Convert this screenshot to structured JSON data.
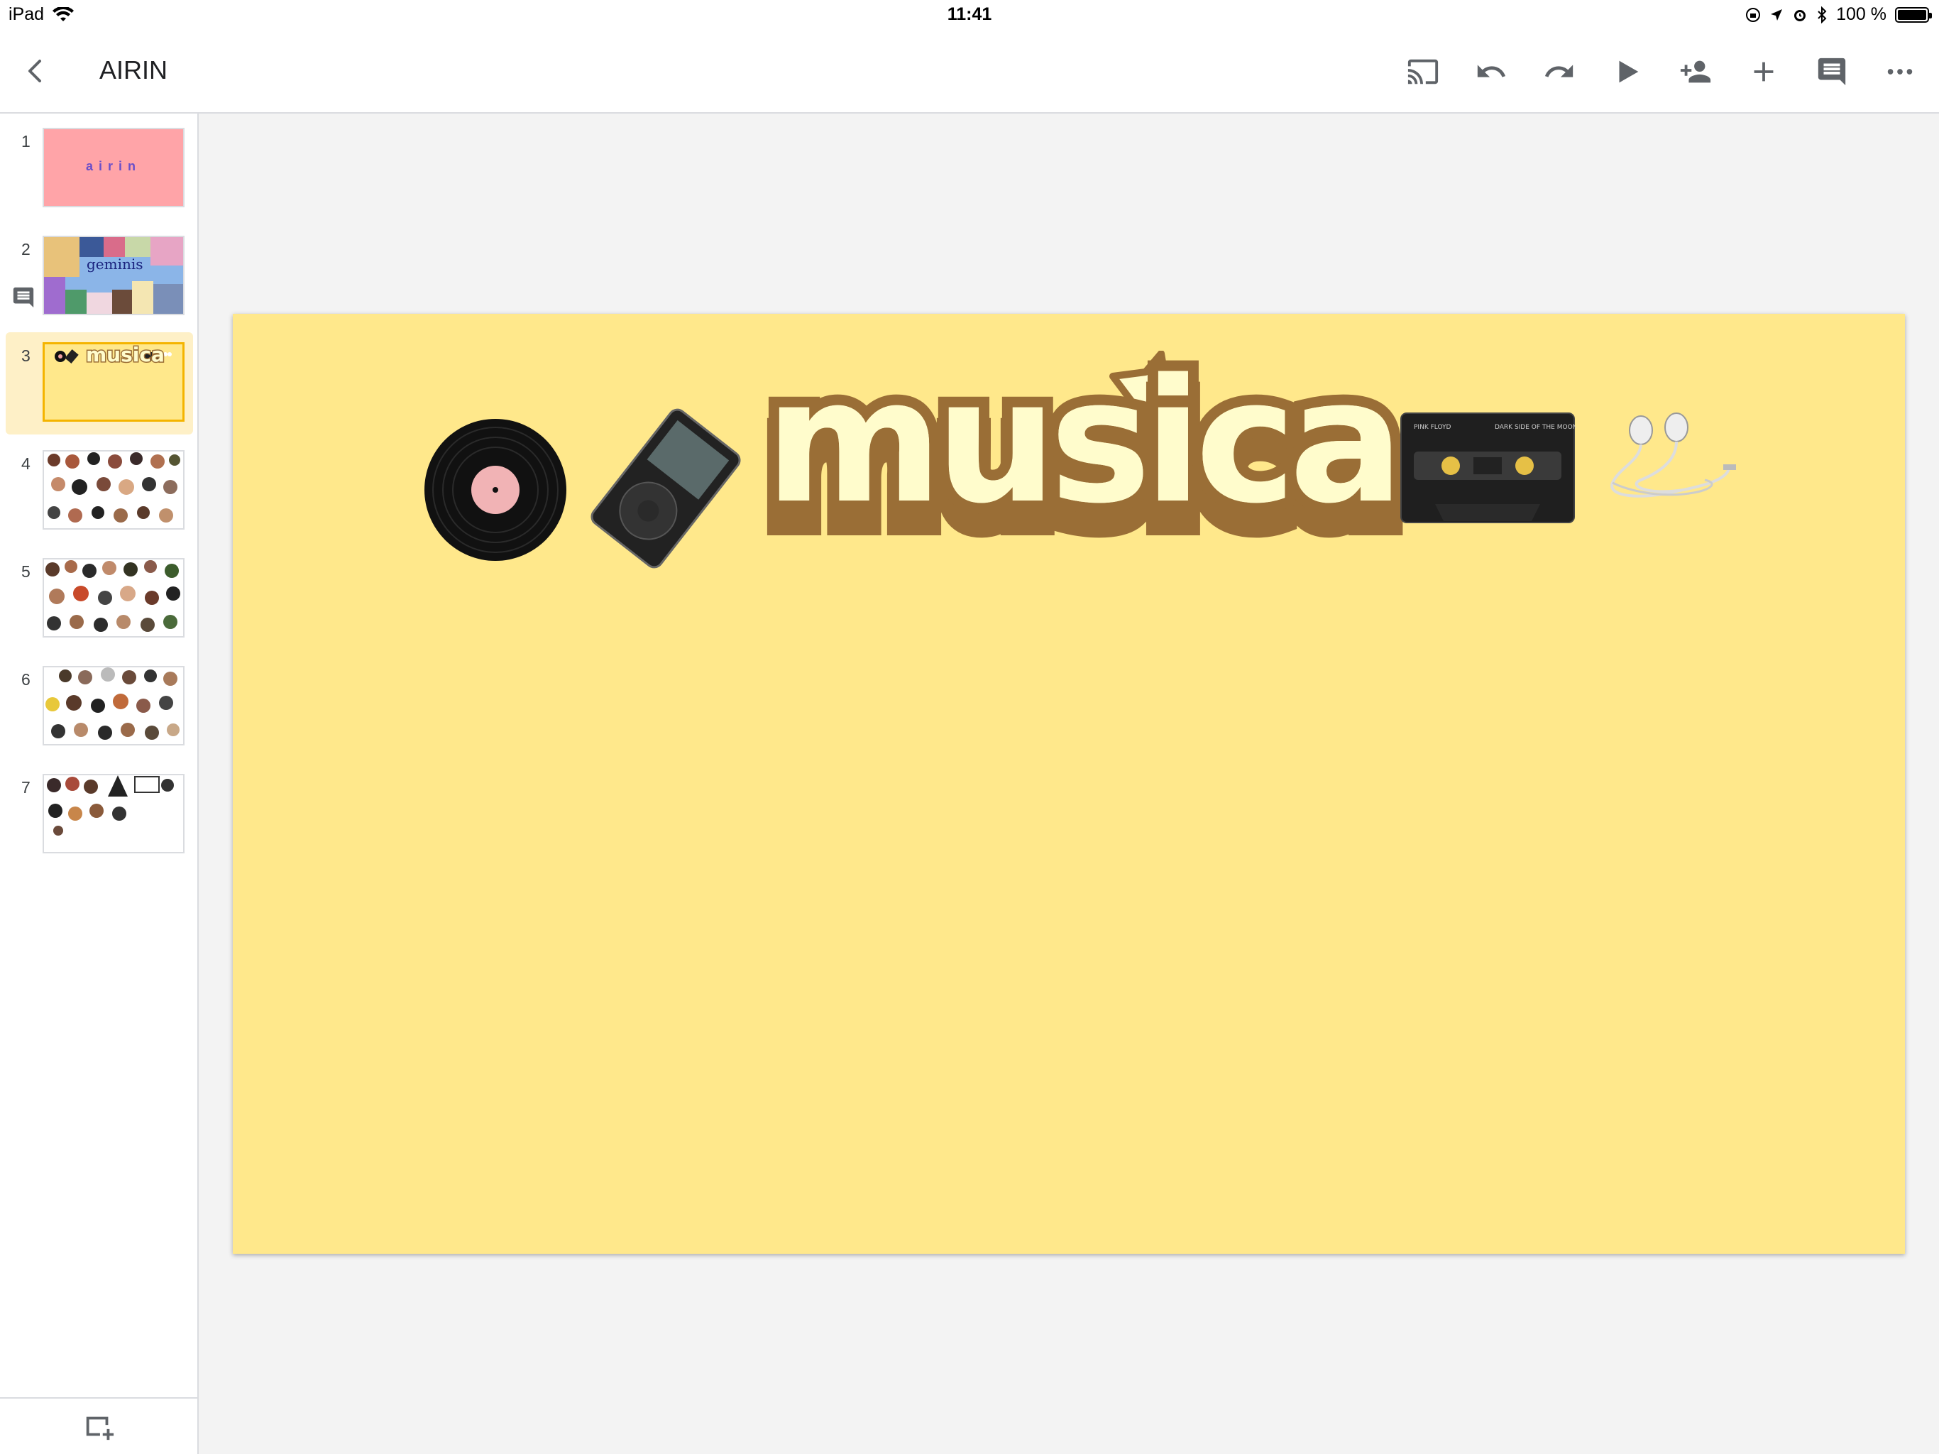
{
  "status_bar": {
    "device": "iPad",
    "time": "11:41",
    "battery": "100 %",
    "battery_level": 1.0
  },
  "app_bar": {
    "title": "AIRIN",
    "toolbar_icons": [
      "cast-icon",
      "undo-icon",
      "redo-icon",
      "play-icon",
      "add-person-icon",
      "plus-icon",
      "comment-icon",
      "more-icon"
    ]
  },
  "sidebar": {
    "slides": [
      {
        "number": "1",
        "bg": "#ffa4a8",
        "text": "airin"
      },
      {
        "number": "2",
        "bg": "#8bb5e8",
        "text": "geminis",
        "has_comment": true
      },
      {
        "number": "3",
        "bg": "#ffe88b",
        "text": "musica",
        "active": true
      },
      {
        "number": "4",
        "bg": "#ffffff"
      },
      {
        "number": "5",
        "bg": "#ffffff"
      },
      {
        "number": "6",
        "bg": "#ffffff"
      },
      {
        "number": "7",
        "bg": "#ffffff"
      }
    ]
  },
  "slide": {
    "bg": "#ffe88b",
    "word": "musica",
    "word_fill": "#fffccc",
    "word_outline": "#9a6e36",
    "cassette": {
      "line1_left": "PINK FLOYD",
      "line1_right": "DARK SIDE OF THE MOON"
    }
  }
}
